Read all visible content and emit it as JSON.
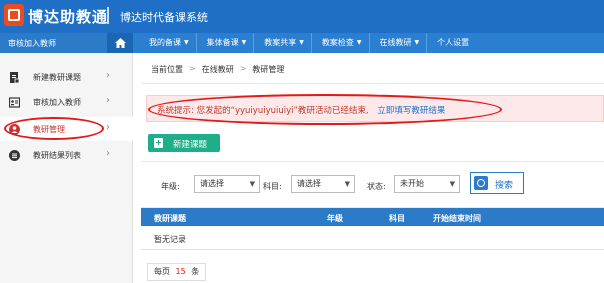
{
  "header": {
    "logo_text": "博达助教通",
    "subtitle": "博达时代备课系统"
  },
  "sidebar": {
    "title": "审核加入教师",
    "items": [
      {
        "label": "新建教研课题",
        "icon": "file-edit-icon"
      },
      {
        "label": "审核加入教师",
        "icon": "id-card-icon"
      },
      {
        "label": "教研管理",
        "icon": "user-circle-icon",
        "active": true
      },
      {
        "label": "教研结果列表",
        "icon": "list-circle-icon"
      }
    ]
  },
  "nav": {
    "items": [
      {
        "label": "我的备课",
        "dropdown": true
      },
      {
        "label": "集体备课",
        "dropdown": true
      },
      {
        "label": "教案共享",
        "dropdown": true
      },
      {
        "label": "教案检查",
        "dropdown": true
      },
      {
        "label": "在线教研",
        "dropdown": true
      },
      {
        "label": "个人设置",
        "dropdown": false
      }
    ]
  },
  "breadcrumb": {
    "items": [
      "当前位置",
      "在线教研",
      "教研管理"
    ]
  },
  "notice": {
    "prefix": "系统提示:",
    "message": "您发起的“yyuiyuiyuiuiyi”教研活动已经结束,",
    "link": "立即填写教研结果"
  },
  "actions": {
    "new_topic": "新建课题"
  },
  "filters": {
    "grade_label": "年级:",
    "grade_value": "请选择",
    "subject_label": "科目:",
    "subject_value": "请选择",
    "status_label": "状态:",
    "status_value": "未开始",
    "search": "搜索"
  },
  "table": {
    "columns": [
      "教研课题",
      "年级",
      "科目",
      "开始结束时间"
    ],
    "empty_text": "暂无记录"
  },
  "pager": {
    "prefix": "每页",
    "per_page": "15",
    "suffix": "条"
  },
  "colors": {
    "header_bg": "#1f6fc6",
    "nav_bg": "#2a7fd1",
    "accent_green": "#1fae8a",
    "notice_text": "#c0392b",
    "highlight_red": "#e31818"
  }
}
